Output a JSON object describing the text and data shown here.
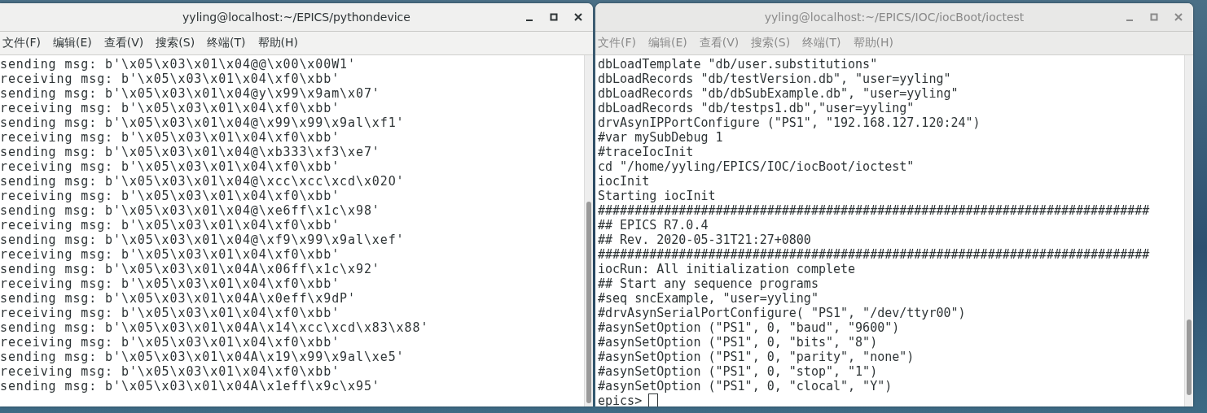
{
  "windows": [
    {
      "title": "yyling@localhost:~/EPICS/pythondevice",
      "active": true,
      "menu": [
        "文件(F)",
        "编辑(E)",
        "查看(V)",
        "搜索(S)",
        "终端(T)",
        "帮助(H)"
      ],
      "lines": [
        "sending msg: b'\\x05\\x03\\x01\\x04@@\\x00\\x00W1'",
        "receiving msg: b'\\x05\\x03\\x01\\x04\\xf0\\xbb'",
        "sending msg: b'\\x05\\x03\\x01\\x04@y\\x99\\x9am\\x07'",
        "receiving msg: b'\\x05\\x03\\x01\\x04\\xf0\\xbb'",
        "sending msg: b'\\x05\\x03\\x01\\x04@\\x99\\x99\\x9al\\xf1'",
        "receiving msg: b'\\x05\\x03\\x01\\x04\\xf0\\xbb'",
        "sending msg: b'\\x05\\x03\\x01\\x04@\\xb333\\xf3\\xe7'",
        "receiving msg: b'\\x05\\x03\\x01\\x04\\xf0\\xbb'",
        "sending msg: b'\\x05\\x03\\x01\\x04@\\xcc\\xcc\\xcd\\x02O'",
        "receiving msg: b'\\x05\\x03\\x01\\x04\\xf0\\xbb'",
        "sending msg: b'\\x05\\x03\\x01\\x04@\\xe6ff\\x1c\\x98'",
        "receiving msg: b'\\x05\\x03\\x01\\x04\\xf0\\xbb'",
        "sending msg: b'\\x05\\x03\\x01\\x04@\\xf9\\x99\\x9al\\xef'",
        "receiving msg: b'\\x05\\x03\\x01\\x04\\xf0\\xbb'",
        "sending msg: b'\\x05\\x03\\x01\\x04A\\x06ff\\x1c\\x92'",
        "receiving msg: b'\\x05\\x03\\x01\\x04\\xf0\\xbb'",
        "sending msg: b'\\x05\\x03\\x01\\x04A\\x0eff\\x9dP'",
        "receiving msg: b'\\x05\\x03\\x01\\x04\\xf0\\xbb'",
        "sending msg: b'\\x05\\x03\\x01\\x04A\\x14\\xcc\\xcd\\x83\\x88'",
        "receiving msg: b'\\x05\\x03\\x01\\x04\\xf0\\xbb'",
        "sending msg: b'\\x05\\x03\\x01\\x04A\\x19\\x99\\x9al\\xe5'",
        "receiving msg: b'\\x05\\x03\\x01\\x04\\xf0\\xbb'",
        "sending msg: b'\\x05\\x03\\x01\\x04A\\x1eff\\x9c\\x95'"
      ]
    },
    {
      "title": "yyling@localhost:~/EPICS/IOC/iocBoot/ioctest",
      "active": false,
      "menu": [
        "文件(F)",
        "编辑(E)",
        "查看(V)",
        "搜索(S)",
        "终端(T)",
        "帮助(H)"
      ],
      "lines": [
        "dbLoadTemplate \"db/user.substitutions\"",
        "dbLoadRecords \"db/testVersion.db\", \"user=yyling\"",
        "dbLoadRecords \"db/dbSubExample.db\", \"user=yyling\"",
        "dbLoadRecords \"db/testps1.db\",\"user=yyling\"",
        "drvAsynIPPortConfigure (\"PS1\", \"192.168.127.120:24\")",
        "#var mySubDebug 1",
        "#traceIocInit",
        "cd \"/home/yyling/EPICS/IOC/iocBoot/ioctest\"",
        "iocInit",
        "Starting iocInit",
        "###########################################################################",
        "## EPICS R7.0.4",
        "## Rev. 2020-05-31T21:27+0800",
        "###########################################################################",
        "iocRun: All initialization complete",
        "## Start any sequence programs",
        "#seq sncExample, \"user=yyling\"",
        "#drvAsynSerialPortConfigure( \"PS1\", \"/dev/ttyr00\")",
        "#asynSetOption (\"PS1\", 0, \"baud\", \"9600\")",
        "#asynSetOption (\"PS1\", 0, \"bits\", \"8\")",
        "#asynSetOption (\"PS1\", 0, \"parity\", \"none\")",
        "#asynSetOption (\"PS1\", 0, \"stop\", \"1\")",
        "#asynSetOption (\"PS1\", 0, \"clocal\", \"Y\")"
      ],
      "prompt": "epics>"
    }
  ]
}
